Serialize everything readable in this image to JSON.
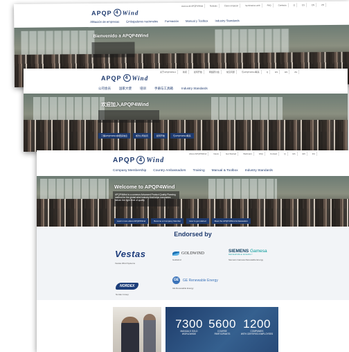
{
  "logo": {
    "prefix": "APQP",
    "number": "4",
    "suffix": "Wind",
    "trademark": "®"
  },
  "screens": {
    "spanish": {
      "util": [
        "Acerca de APQP4Wind",
        "Noticias",
        "Cómo empezar",
        "Seminarios web",
        "FAQ",
        "Contacto",
        "Q",
        "ES",
        "EN",
        "ZH"
      ],
      "nav": [
        "Afiliación de empresas",
        "Embajadores nacionales",
        "Formación",
        "Manual y Toolbox",
        "Industry Standards"
      ],
      "hero_title": "Bienvenido a APQP4Wind"
    },
    "chinese": {
      "util": [
        "关于APQP4Wind",
        "新闻",
        "如何开始",
        "网络研讨会",
        "常见问题",
        "与APQP4Wind联系",
        "Q",
        "ES",
        "EN",
        "ZH"
      ],
      "nav": [
        "公司会员",
        "国家大使",
        "培训",
        "手册与工具箱",
        "Industry Standards"
      ],
      "hero_title": "欢迎加入APQP4Wind",
      "buttons": [
        "了解APQP4Wind的更多信息",
        "成为公司会员",
        "如何开始",
        "与APQP4Wind联系"
      ]
    },
    "english": {
      "util": [
        "About APQP4Wind",
        "News",
        "Get Started",
        "Webinars",
        "FAQ",
        "Contact",
        "Q",
        "ES",
        "EN",
        "ZH"
      ],
      "nav": [
        "Company Membership",
        "Country Ambassadors",
        "Training",
        "Manual & Toolbox",
        "Industry Standards"
      ],
      "hero_title": "Welcome to APQP4Wind",
      "hero_body": "APQP4Wind is a common Advanced Product Quality Planning method for the global wind industry that helps companies deliver the right level of quality",
      "buttons": [
        "Learn more about APQP4Wind",
        "Become a Company Member",
        "How to get started",
        "Meet the APQP4Wind Ambassadors"
      ],
      "endorsed_title": "Endorsed by",
      "endorsers": {
        "vestas": {
          "logo": "Vestas",
          "name": "Vestas Wind Systems"
        },
        "goldwind": {
          "logo": "GOLDWIND",
          "name": "Goldwind"
        },
        "siemens": {
          "logo_a": "SIEMENS",
          "logo_b": "Gamesa",
          "logo_sub": "RENEWABLE ENERGY",
          "name": "Siemens Gamesa Renewable Energy"
        },
        "nordex": {
          "logo": "NORDEX",
          "name": "Nordex Group"
        },
        "ge": {
          "logo_mark": "GE",
          "logo": "GE Renewable Energy",
          "name": "GE Renewable Energy"
        }
      },
      "stats": [
        {
          "value": "7300",
          "label_1": "MANUALS SOLD",
          "label_2": "WORLDWIDE"
        },
        {
          "value": "5600",
          "label_1": "COURSE",
          "label_2": "PARTICIPANTS"
        },
        {
          "value": "1200",
          "label_1": "COMPANIES",
          "label_2": "WITH CERTIFIED EMPLOYEES"
        }
      ]
    }
  },
  "colors": {
    "brand_navy": "#1e3a6e",
    "siemens_teal": "#009999",
    "ge_blue": "#3b73b9"
  }
}
